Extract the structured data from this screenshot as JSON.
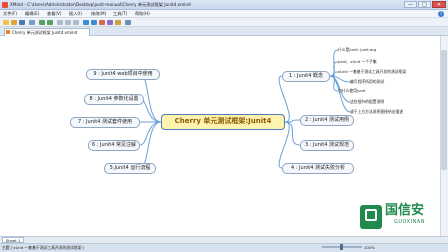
{
  "window": {
    "title": "XMind - C:\\Users\\Administrator\\Desktop\\junit-manual\\Cherry 单元测试框架 Junit4.xmind",
    "controls": {
      "minimize": "—",
      "maximize": "□",
      "close": "✕"
    }
  },
  "menu": [
    "文件(F)",
    "编辑(E)",
    "查看(V)",
    "插入(I)",
    "修改(M)",
    "工具(T)",
    "帮助(H)"
  ],
  "tab": {
    "label": "Cherry 单元测试框架 Junit4.xmind"
  },
  "mindmap": {
    "central": "Cherry 单元测试框架:Junit4",
    "right": [
      {
        "label": "1 : Junit4 概念"
      },
      {
        "label": "2 : Junit4 测试用例"
      },
      {
        "label": "3 : Junit4 测试规范"
      },
      {
        "label": "4 : Junit4 测试失败分析"
      }
    ],
    "left": [
      {
        "label": "9 : Junit4 web项目中使用"
      },
      {
        "label": "8 : Junit4 参数化设置"
      },
      {
        "label": "7 : Junit4 测试套件使用"
      },
      {
        "label": "6 : Junit4 常见注解"
      },
      {
        "label": "5:Junit4 运行流程"
      }
    ],
    "subtopics": [
      "什么是Junit: junit.org",
      "Junit、xUnit 一个子集",
      "xUnit 一套基于测试工具开发的测试框架",
      "编写程序所用的测试",
      "为什么使用Junit",
      "这些细节的配置说明",
      "或于上方方法说明直接给出描述"
    ]
  },
  "sheet": {
    "label": "Sheet 1"
  },
  "status": {
    "text": "主题 ('xUnit 一套基于测试工具开发的测试框架')",
    "zoom": "100%"
  },
  "watermark": {
    "name": "国信安",
    "latin": "GUOXINAN"
  },
  "colors": {
    "accent": "#4f7bb6",
    "central_fill": "#fff3b0",
    "central_text": "#8a5a00",
    "logo": "#1f8a4c"
  }
}
